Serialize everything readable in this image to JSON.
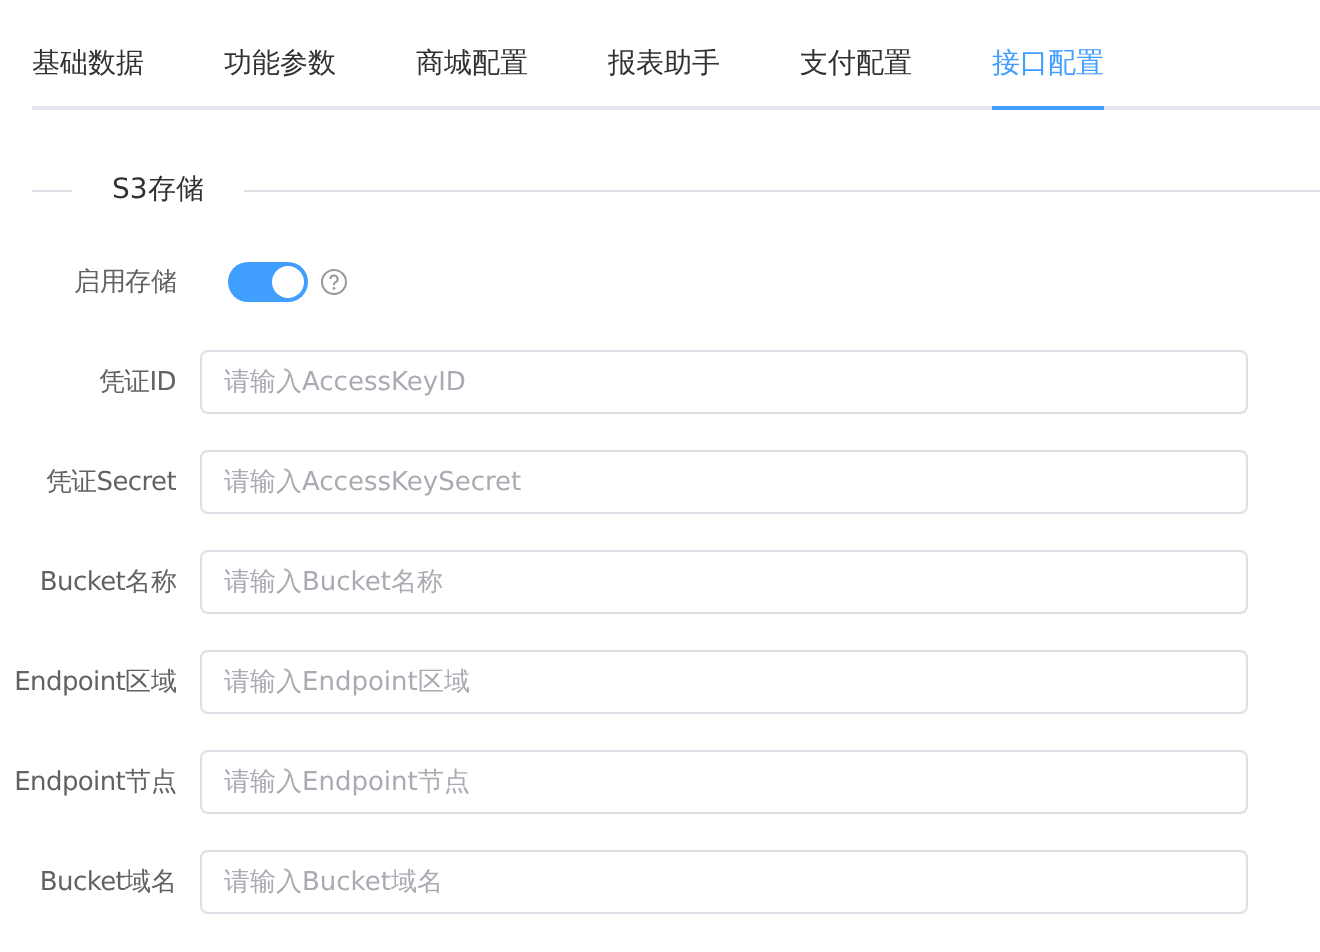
{
  "tabs": [
    {
      "label": "基础数据",
      "selected": false
    },
    {
      "label": "功能参数",
      "selected": false
    },
    {
      "label": "商城配置",
      "selected": false
    },
    {
      "label": "报表助手",
      "selected": false
    },
    {
      "label": "支付配置",
      "selected": false
    },
    {
      "label": "接口配置",
      "selected": true
    }
  ],
  "section": {
    "title": "S3存储"
  },
  "switch_row": {
    "label": "启用存储",
    "on": true
  },
  "fields": [
    {
      "label": "凭证ID",
      "placeholder": "请输入AccessKeyID"
    },
    {
      "label": "凭证Secret",
      "placeholder": "请输入AccessKeySecret"
    },
    {
      "label": "Bucket名称",
      "placeholder": "请输入Bucket名称"
    },
    {
      "label": "Endpoint区域",
      "placeholder": "请输入Endpoint区域"
    },
    {
      "label": "Endpoint节点",
      "placeholder": "请输入Endpoint节点"
    },
    {
      "label": "Bucket域名",
      "placeholder": "请输入Bucket域名"
    }
  ]
}
